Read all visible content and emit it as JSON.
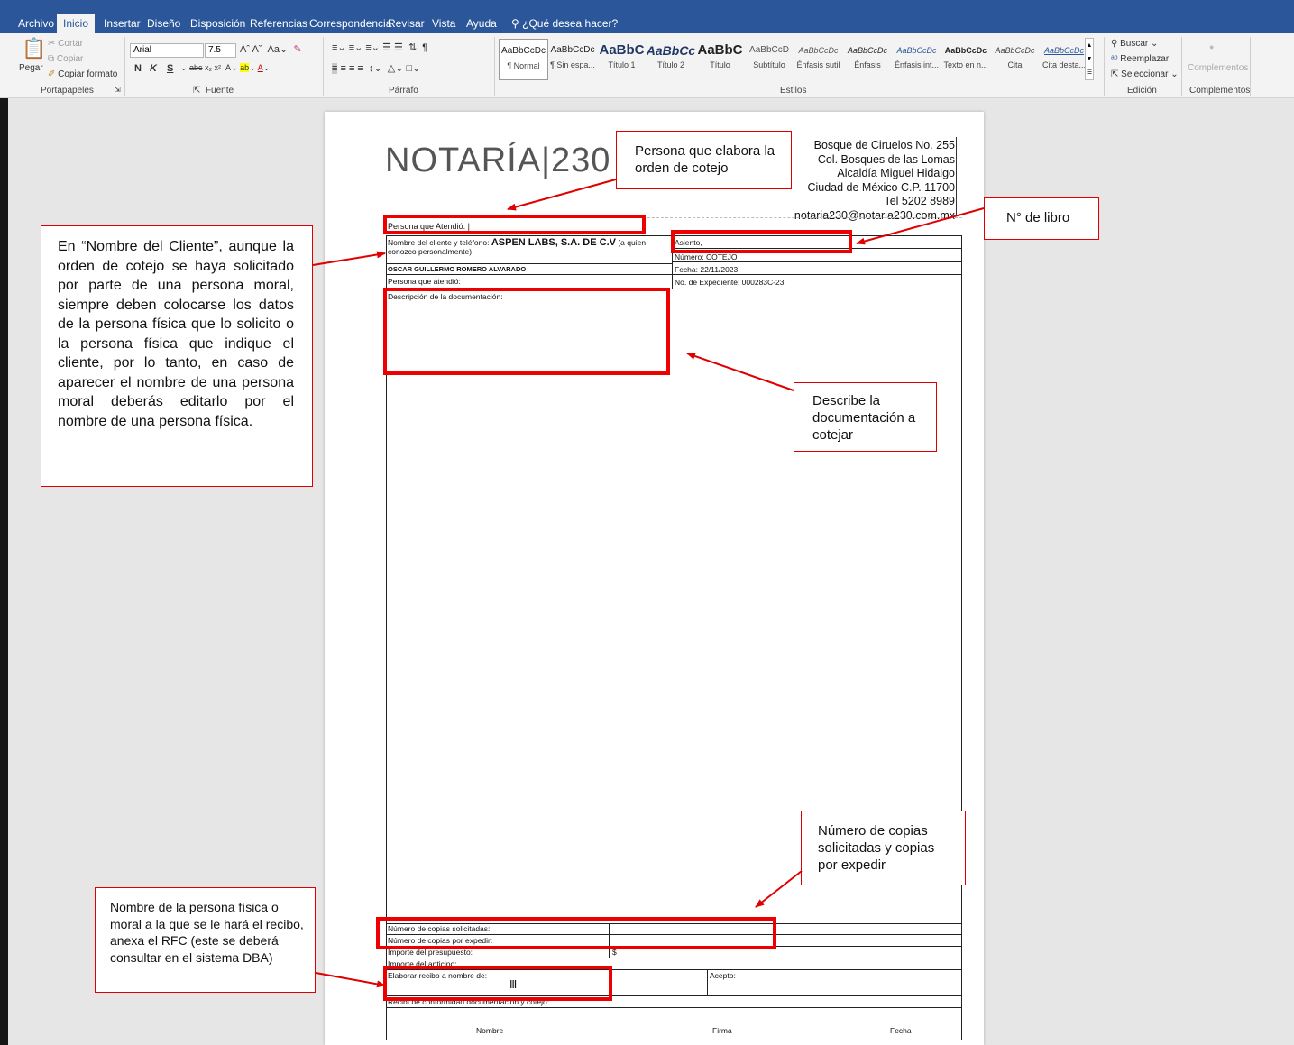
{
  "tabs": [
    "Archivo",
    "Inicio",
    "Insertar",
    "Diseño",
    "Disposición",
    "Referencias",
    "Correspondencia",
    "Revisar",
    "Vista",
    "Ayuda",
    "¿Qué desea hacer?"
  ],
  "clipboard": {
    "paste": "Pegar",
    "cut": "Cortar",
    "copy": "Copiar",
    "format_painter": "Copiar formato",
    "label": "Portapapeles"
  },
  "font": {
    "name": "Arial",
    "size": "7.5",
    "label": "Fuente",
    "bold": "N",
    "italic": "K",
    "underline": "S"
  },
  "paragraph": {
    "label": "Párrafo"
  },
  "styles": {
    "label": "Estilos",
    "items": [
      {
        "preview": "AaBbCcDc",
        "name": "¶ Normal"
      },
      {
        "preview": "AaBbCcDc",
        "name": "¶ Sin espa..."
      },
      {
        "preview": "AaBbC",
        "name": "Título 1"
      },
      {
        "preview": "AaBbCc",
        "name": "Título 2"
      },
      {
        "preview": "AaBbC",
        "name": "Título"
      },
      {
        "preview": "AaBbCcD",
        "name": "Subtítulo"
      },
      {
        "preview": "AaBbCcDc",
        "name": "Énfasis sutil"
      },
      {
        "preview": "AaBbCcDc",
        "name": "Énfasis"
      },
      {
        "preview": "AaBbCcDc",
        "name": "Énfasis int..."
      },
      {
        "preview": "AaBbCcDc",
        "name": "Texto en n..."
      },
      {
        "preview": "AaBbCcDc",
        "name": "Cita"
      },
      {
        "preview": "AaBbCcDc",
        "name": "Cita desta..."
      }
    ]
  },
  "editing": {
    "find": "Buscar",
    "replace": "Reemplazar",
    "select": "Seleccionar",
    "label": "Edición"
  },
  "addins": {
    "button": "Complementos",
    "label": "Complementos"
  },
  "doc": {
    "logo": "NOTARÍA|230",
    "address": [
      "Bosque de Ciruelos No. 255",
      "Col. Bosques de las Lomas",
      "Alcaldía Miguel Hidalgo",
      "Ciudad de México C.P. 11700",
      "Tel 5202 8989",
      "notaria230@notaria230.com.mx"
    ],
    "persona_atendio_top": "Persona que Atendió:",
    "client_label": "Nombre del cliente y teléfono:",
    "client_value": "ASPEN LABS, S.A. DE C.V",
    "client_suffix": "(a quien",
    "client_line2": "conozco personalmente)",
    "client_person": "OSCAR GUILLERMO ROMERO ALVARADO",
    "persona_atendio": "Persona que atendió:",
    "asiento": "Asiento,",
    "numero": "Número:  COTEJO",
    "fecha": "Fecha:  22/11/2023",
    "expediente": "No. de Expediente:   000283C-23",
    "descripcion": "Descripción de la documentación:",
    "copias_solicitadas": "Número de copias solicitadas:",
    "copias_expedir": "Número de copias por expedir:",
    "importe_presupuesto": "Importe del presupuesto:",
    "importe_currency": "$",
    "importe_anticipo": "Importe del anticipo:",
    "elaborar_recibo": "Elaborar recibo a nombre de:",
    "acepto": "Acepto:",
    "recibi": "Recibí de conformidad documentación y cotejo:",
    "footer": [
      "Nombre",
      "Firma",
      "Fecha"
    ]
  },
  "callouts": {
    "elabora": "Persona que elabora la orden de cotejo",
    "libro": "N° de libro",
    "cliente": "En “Nombre del Cliente”, aunque la orden de cotejo se haya solicitado por parte de una persona moral, siempre deben colocarse los datos de la persona física que lo solicito o la persona física que indique el cliente, por lo tanto, en caso de aparecer el nombre de una persona moral deberás editarlo por el nombre de una persona física.",
    "describe": "Describe la documentación a cotejar",
    "copias": "Número de copias solicitadas y copias por expedir",
    "recibo": "Nombre de la persona física o moral a la que se le hará el recibo, anexa el RFC (este se deberá consultar en el sistema DBA)"
  },
  "colors": {
    "ribbon_blue": "#2b579a",
    "annotation_red": "#ee0000"
  }
}
